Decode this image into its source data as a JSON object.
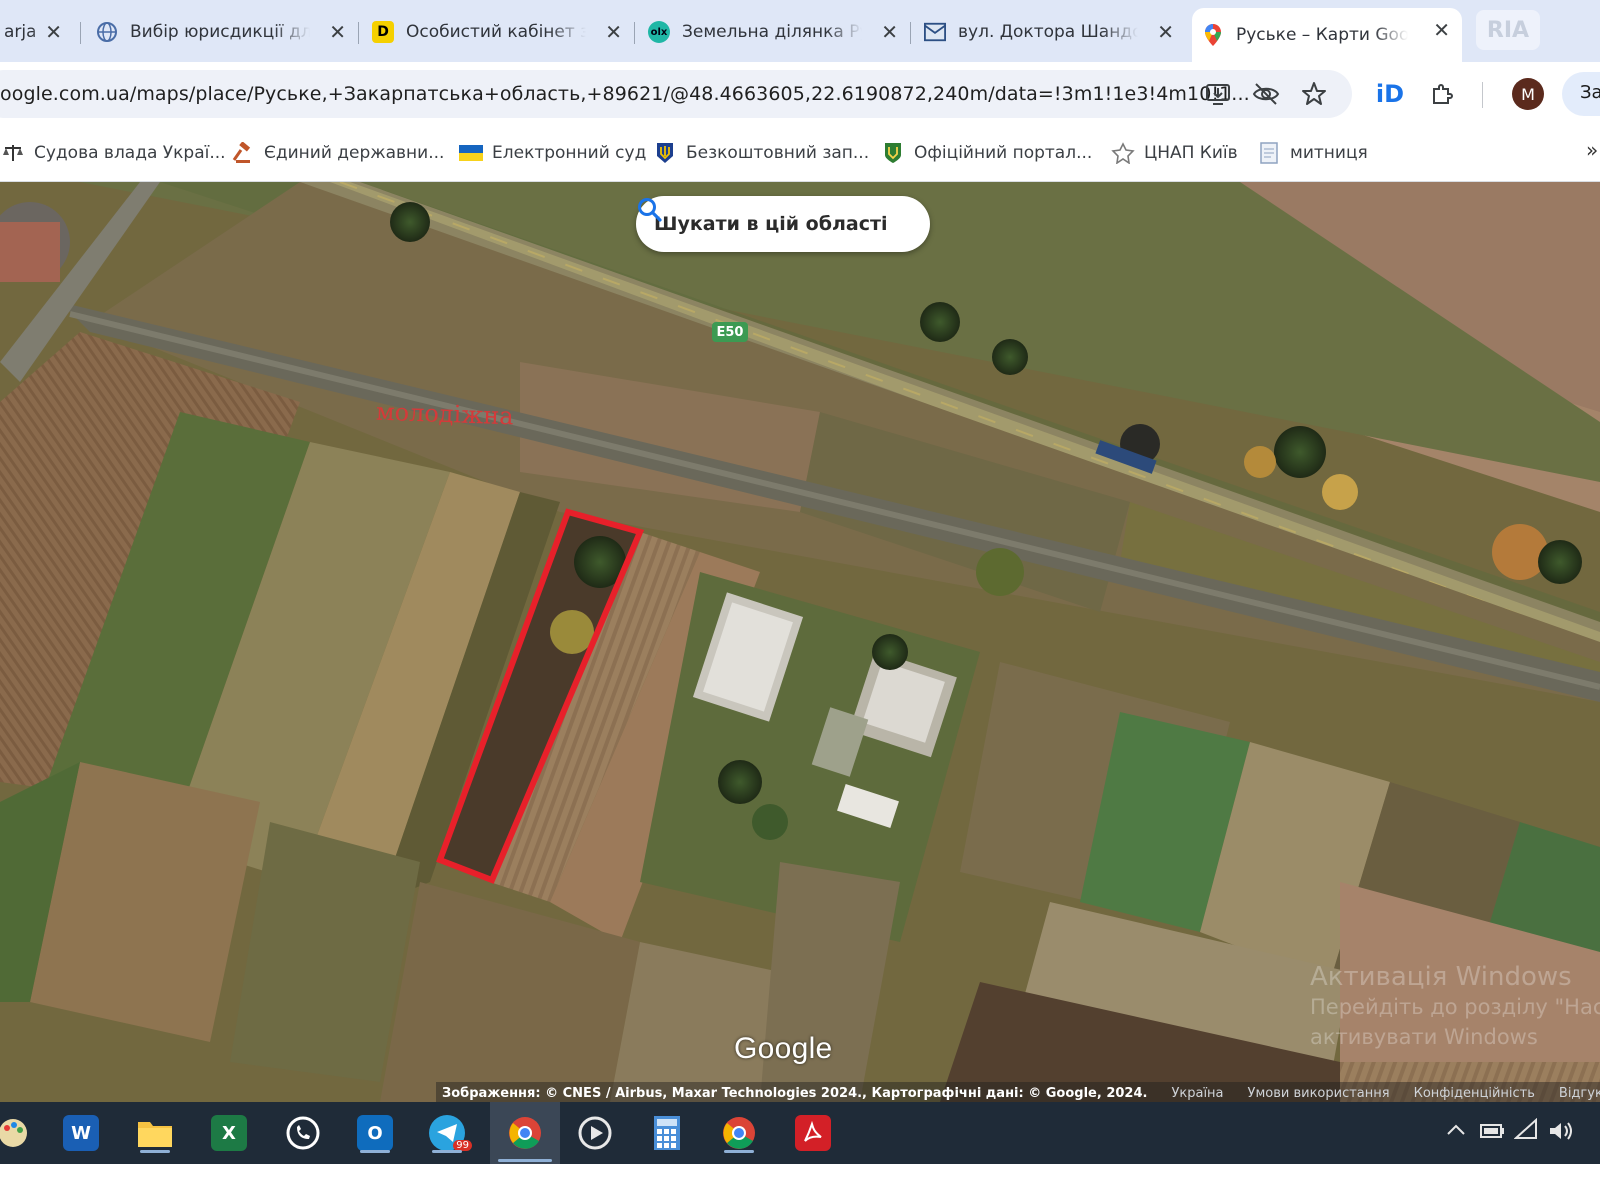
{
  "browser": {
    "tabs": [
      {
        "title": "arja",
        "favicon": "partial-tab-icon"
      },
      {
        "title": "Вибір юрисдикції дл",
        "favicon": "globe-icon"
      },
      {
        "title": "Особистий кабінет з",
        "favicon": "diia-d-icon"
      },
      {
        "title": "Земельна ділянка Ру",
        "favicon": "olx-icon"
      },
      {
        "title": "вул. Доктора Шандо",
        "favicon": "mail-icon"
      },
      {
        "title": "Руське – Карти Goog",
        "favicon": "maps-pin-icon",
        "active": true
      }
    ],
    "new_tab_badge": "RIA",
    "address": "oogle.com.ua/maps/place/Руське,+Закарпатська+область,+89621/@48.4663605,22.6190872,240m/data=!3m1!1e3!4m10!1...",
    "profile_initial": "M",
    "side_button_label": "Зав",
    "bookmarks": [
      {
        "label": "Судова влада Украї...",
        "icon": "scales-icon"
      },
      {
        "label": "Єдиний державни...",
        "icon": "gavel-icon"
      },
      {
        "label": "Електронний суд",
        "icon": "ukraine-flag-icon"
      },
      {
        "label": "Безкоштовний зап...",
        "icon": "trident-icon"
      },
      {
        "label": "Офіційний портал...",
        "icon": "shield-icon"
      },
      {
        "label": "ЦНАП Київ",
        "icon": "cnap-icon"
      },
      {
        "label": "митниця",
        "icon": "document-icon"
      }
    ]
  },
  "map": {
    "search_area_label": "Шукати в цій області",
    "road_shield": "E50",
    "street_label": "молодіжна",
    "logo": "Google",
    "attribution": "Зображення: © CNES / Airbus, Maxar Technologies 2024., Картографічні дані: © Google, 2024.",
    "links": [
      "Україна",
      "Умови використання",
      "Конфіденційність",
      "Відгук про п"
    ],
    "highlight_color": "#e8202a",
    "watermark": {
      "line1": "Активація Windows",
      "line2": "Перейдіть до розділу \"Наст",
      "line3": "активувати Windows"
    }
  },
  "taskbar": {
    "apps": [
      {
        "name": "paint-icon"
      },
      {
        "name": "word-icon",
        "letter": "W"
      },
      {
        "name": "file-explorer-icon"
      },
      {
        "name": "excel-icon",
        "letter": "X"
      },
      {
        "name": "whatsapp-icon"
      },
      {
        "name": "outlook-icon",
        "letter": "O"
      },
      {
        "name": "telegram-icon",
        "badge": "99"
      },
      {
        "name": "chrome-icon",
        "active": true
      },
      {
        "name": "media-player-icon"
      },
      {
        "name": "calculator-icon"
      },
      {
        "name": "chrome-profile-icon"
      },
      {
        "name": "acrobat-icon"
      }
    ]
  }
}
